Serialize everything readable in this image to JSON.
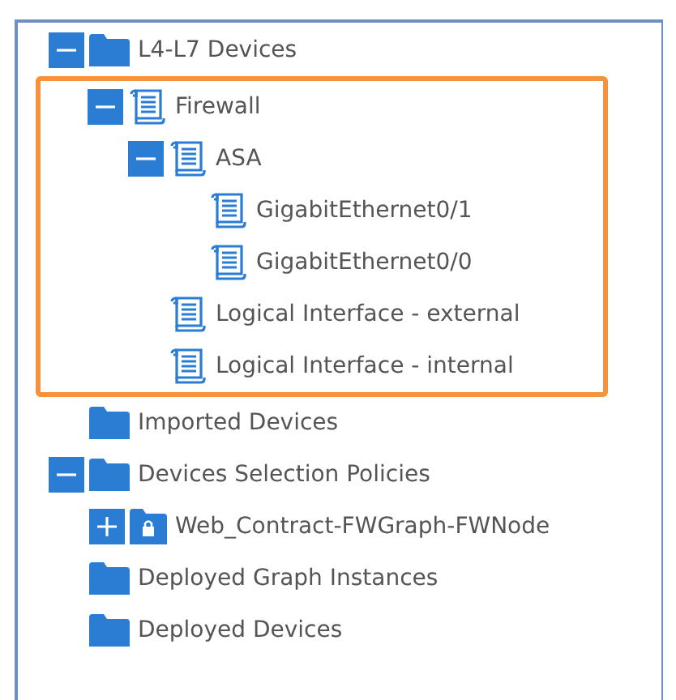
{
  "tree": [
    {
      "label": "L4-L7 Devices",
      "kind": "folder",
      "expanded": true,
      "children": [
        {
          "label": "Firewall",
          "kind": "document",
          "expanded": true,
          "highlighted": true,
          "children": [
            {
              "label": "ASA",
              "kind": "document",
              "expanded": true,
              "children": [
                {
                  "label": "GigabitEthernet0/1",
                  "kind": "document"
                },
                {
                  "label": "GigabitEthernet0/0",
                  "kind": "document"
                }
              ]
            },
            {
              "label": "Logical Interface - external",
              "kind": "document"
            },
            {
              "label": "Logical Interface - internal",
              "kind": "document"
            }
          ]
        }
      ]
    },
    {
      "label": "Imported Devices",
      "kind": "folder"
    },
    {
      "label": "Devices Selection Policies",
      "kind": "folder",
      "expanded": true,
      "children": [
        {
          "label": "Web_Contract-FWGraph-FWNode",
          "kind": "locked",
          "expanded": false
        }
      ]
    },
    {
      "label": "Deployed Graph Instances",
      "kind": "folder"
    },
    {
      "label": "Deployed Devices",
      "kind": "folder"
    }
  ]
}
